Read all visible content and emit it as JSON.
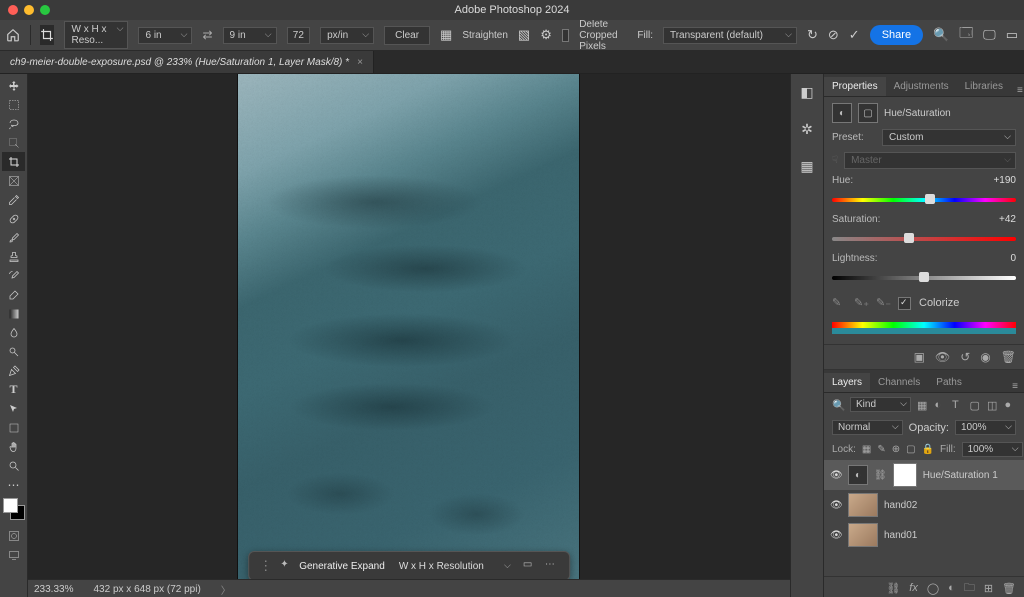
{
  "title": "Adobe Photoshop 2024",
  "doc_tab": "ch9-meier-double-exposure.psd @ 233% (Hue/Saturation 1, Layer Mask/8) *",
  "options": {
    "preset": "W x H x Reso...",
    "w": "6 in",
    "h": "9 in",
    "res": "72",
    "resunit": "px/in",
    "clear": "Clear",
    "straighten": "Straighten",
    "delete_cropped": "Delete Cropped Pixels",
    "fill_label": "Fill:",
    "fill": "Transparent (default)",
    "share": "Share"
  },
  "context": {
    "gen": "Generative Expand",
    "res": "W x H x Resolution"
  },
  "status": {
    "zoom": "233.33%",
    "dims": "432 px x 648 px (72 ppi)"
  },
  "panels": {
    "properties": "Properties",
    "adjustments": "Adjustments",
    "libraries": "Libraries"
  },
  "hs": {
    "title": "Hue/Saturation",
    "preset_lbl": "Preset:",
    "preset": "Custom",
    "master": "Master",
    "hue_lbl": "Hue:",
    "hue": "+190",
    "sat_lbl": "Saturation:",
    "sat": "+42",
    "lit_lbl": "Lightness:",
    "lit": "0",
    "colorize": "Colorize"
  },
  "layertabs": {
    "layers": "Layers",
    "channels": "Channels",
    "paths": "Paths"
  },
  "layers": {
    "kind": "Kind",
    "blend": "Normal",
    "opacity_lbl": "Opacity:",
    "opacity": "100%",
    "lock_lbl": "Lock:",
    "fill_lbl": "Fill:",
    "fill": "100%",
    "items": [
      {
        "name": "Hue/Saturation 1",
        "type": "adj",
        "sel": true
      },
      {
        "name": "hand02",
        "type": "img"
      },
      {
        "name": "hand01",
        "type": "img"
      }
    ]
  }
}
